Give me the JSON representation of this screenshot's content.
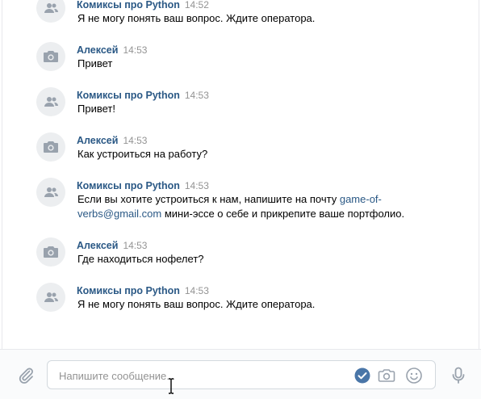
{
  "messages": [
    {
      "author": "Комиксы про Python",
      "time": "14:52",
      "text": "Я не могу понять ваш вопрос. Ждите оператора.",
      "avatar": "group-icon"
    },
    {
      "author": "Алексей",
      "time": "14:53",
      "text": "Привет",
      "avatar": "camera-icon"
    },
    {
      "author": "Комиксы про Python",
      "time": "14:53",
      "text": "Привет!",
      "avatar": "group-icon"
    },
    {
      "author": "Алексей",
      "time": "14:53",
      "text": "Как устроиться на работу?",
      "avatar": "camera-icon"
    },
    {
      "author": "Комиксы про Python",
      "time": "14:53",
      "text_before": "Если вы хотите устроиться к нам, напишите на почту ",
      "link_part1": "game-of-",
      "link_part2": "verbs@gmail.com",
      "text_after": " мини-эссе о себе и прикрепите ваше портфолио.",
      "avatar": "group-icon"
    },
    {
      "author": "Алексей",
      "time": "14:53",
      "text": "Где находиться нофелет?",
      "avatar": "camera-icon"
    },
    {
      "author": "Комиксы про Python",
      "time": "14:53",
      "text": "Я не могу понять ваш вопрос. Ждите оператора.",
      "avatar": "group-icon"
    }
  ],
  "composer": {
    "placeholder": "Напишите сообщение...",
    "icons": [
      "paperclip-icon",
      "checkmark-icon",
      "camera-icon",
      "smile-icon",
      "microphone-icon"
    ]
  },
  "colors": {
    "author": "#2a5885",
    "accent": "#4a76a8",
    "avatar_bg": "#eceef0",
    "icon": "#99a2ad"
  }
}
